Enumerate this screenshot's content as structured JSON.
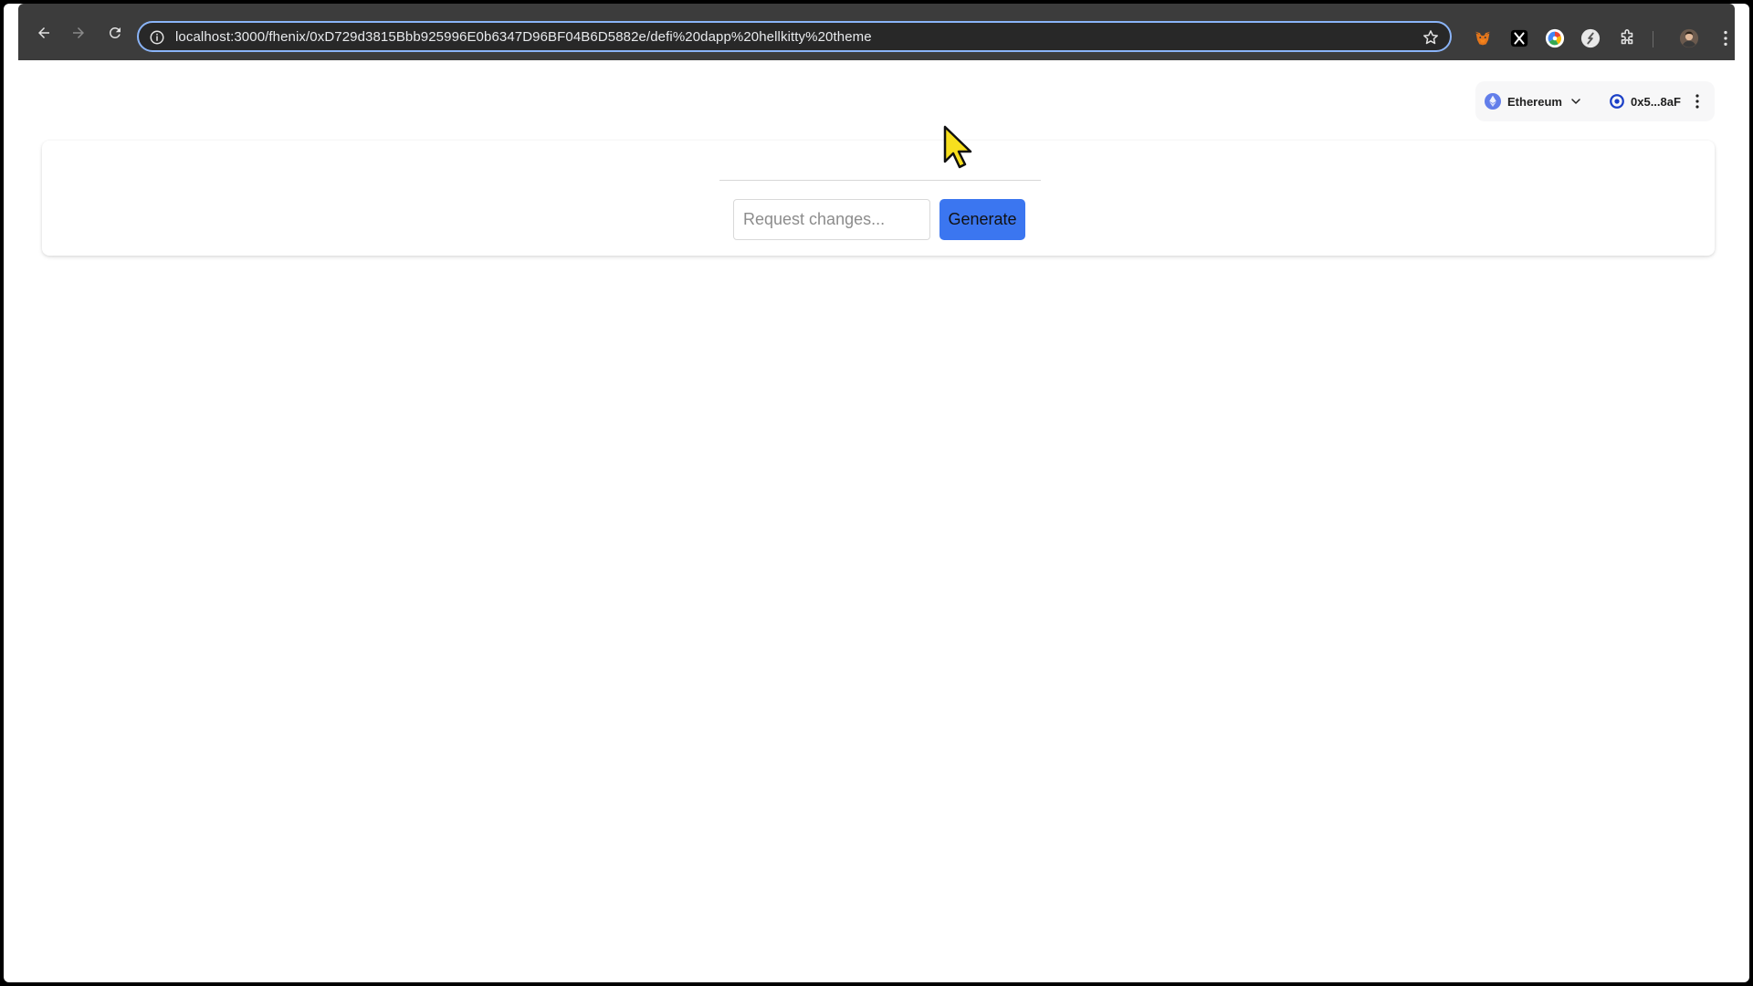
{
  "browser": {
    "url": "localhost:3000/fhenix/0xD729d3815Bbb925996E0b6347D96BF04B6D5882e/defi%20dapp%20hellkitty%20theme",
    "icons": {
      "back": "arrow-left-icon",
      "forward": "arrow-right-icon",
      "reload": "reload-icon",
      "site_info": "info-icon",
      "bookmark": "star-icon",
      "extensions": [
        "metamask-fox-icon",
        "x-logo-icon",
        "color-wheel-icon",
        "compass-icon",
        "puzzle-icon"
      ],
      "profile": "avatar-icon",
      "menu": "kebab-menu-icon"
    }
  },
  "wallet": {
    "network": "Ethereum",
    "account": "0x5...8aF",
    "colors": {
      "eth": "#627eea",
      "account_ring": "#1a3fc7"
    }
  },
  "composer": {
    "input_placeholder": "Request changes...",
    "input_value": "",
    "generate_label": "Generate",
    "button_color": "#3b76f0"
  }
}
